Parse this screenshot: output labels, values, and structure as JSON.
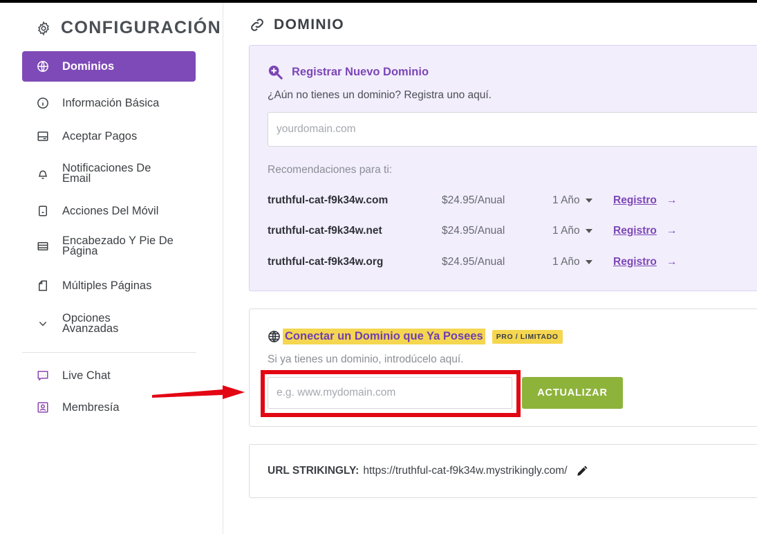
{
  "sidebar": {
    "title": "CONFIGURACIÓN",
    "title_icon": "gear-icon",
    "items": [
      {
        "label": "Dominios",
        "icon": "globe-icon",
        "active": true
      },
      {
        "label": "Información Básica",
        "icon": "info-icon"
      },
      {
        "label": "Aceptar Pagos",
        "icon": "card-icon"
      },
      {
        "label": "Notificaciones De Email",
        "icon": "bell-icon"
      },
      {
        "label": "Acciones Del Móvil",
        "icon": "mobile-icon"
      },
      {
        "label": "Encabezado Y Pie De Página",
        "icon": "layout-icon"
      },
      {
        "label": "Múltiples Páginas",
        "icon": "pages-icon"
      },
      {
        "label": "Opciones Avanzadas",
        "icon": "chevron-down-icon"
      }
    ],
    "extra_items": [
      {
        "label": "Live Chat",
        "icon": "chat-icon"
      },
      {
        "label": "Membresía",
        "icon": "member-icon"
      }
    ]
  },
  "main": {
    "title": "DOMINIO",
    "title_icon": "link-icon",
    "register": {
      "heading": "Registrar Nuevo Dominio",
      "subtitle": "¿Aún no tienes un dominio? Registra uno aquí.",
      "input_placeholder": "yourdomain.com",
      "recommendations_label": "Recomendaciones para ti:",
      "recommendations": [
        {
          "domain": "truthful-cat-f9k34w.com",
          "price": "$24.95/Anual",
          "period": "1 Año",
          "action": "Registro",
          "arrow": "→"
        },
        {
          "domain": "truthful-cat-f9k34w.net",
          "price": "$24.95/Anual",
          "period": "1 Año",
          "action": "Registro",
          "arrow": "→"
        },
        {
          "domain": "truthful-cat-f9k34w.org",
          "price": "$24.95/Anual",
          "period": "1 Año",
          "action": "Registro",
          "arrow": "→"
        }
      ]
    },
    "connect": {
      "heading": "Conectar un Dominio que Ya Posees",
      "badge": "PRO / LIMITADO",
      "subtitle": "Si ya tienes un dominio, introdúcelo aquí.",
      "input_placeholder": "e.g. www.mydomain.com",
      "button_label": "ACTUALIZAR"
    },
    "url": {
      "label": "URL STRIKINGLY:",
      "value": "https://truthful-cat-f9k34w.mystrikingly.com/"
    }
  },
  "colors": {
    "accent": "#7e4ab7",
    "highlight": "#f5d650",
    "button_green": "#8eb33b",
    "annotation_red": "#e30613"
  }
}
